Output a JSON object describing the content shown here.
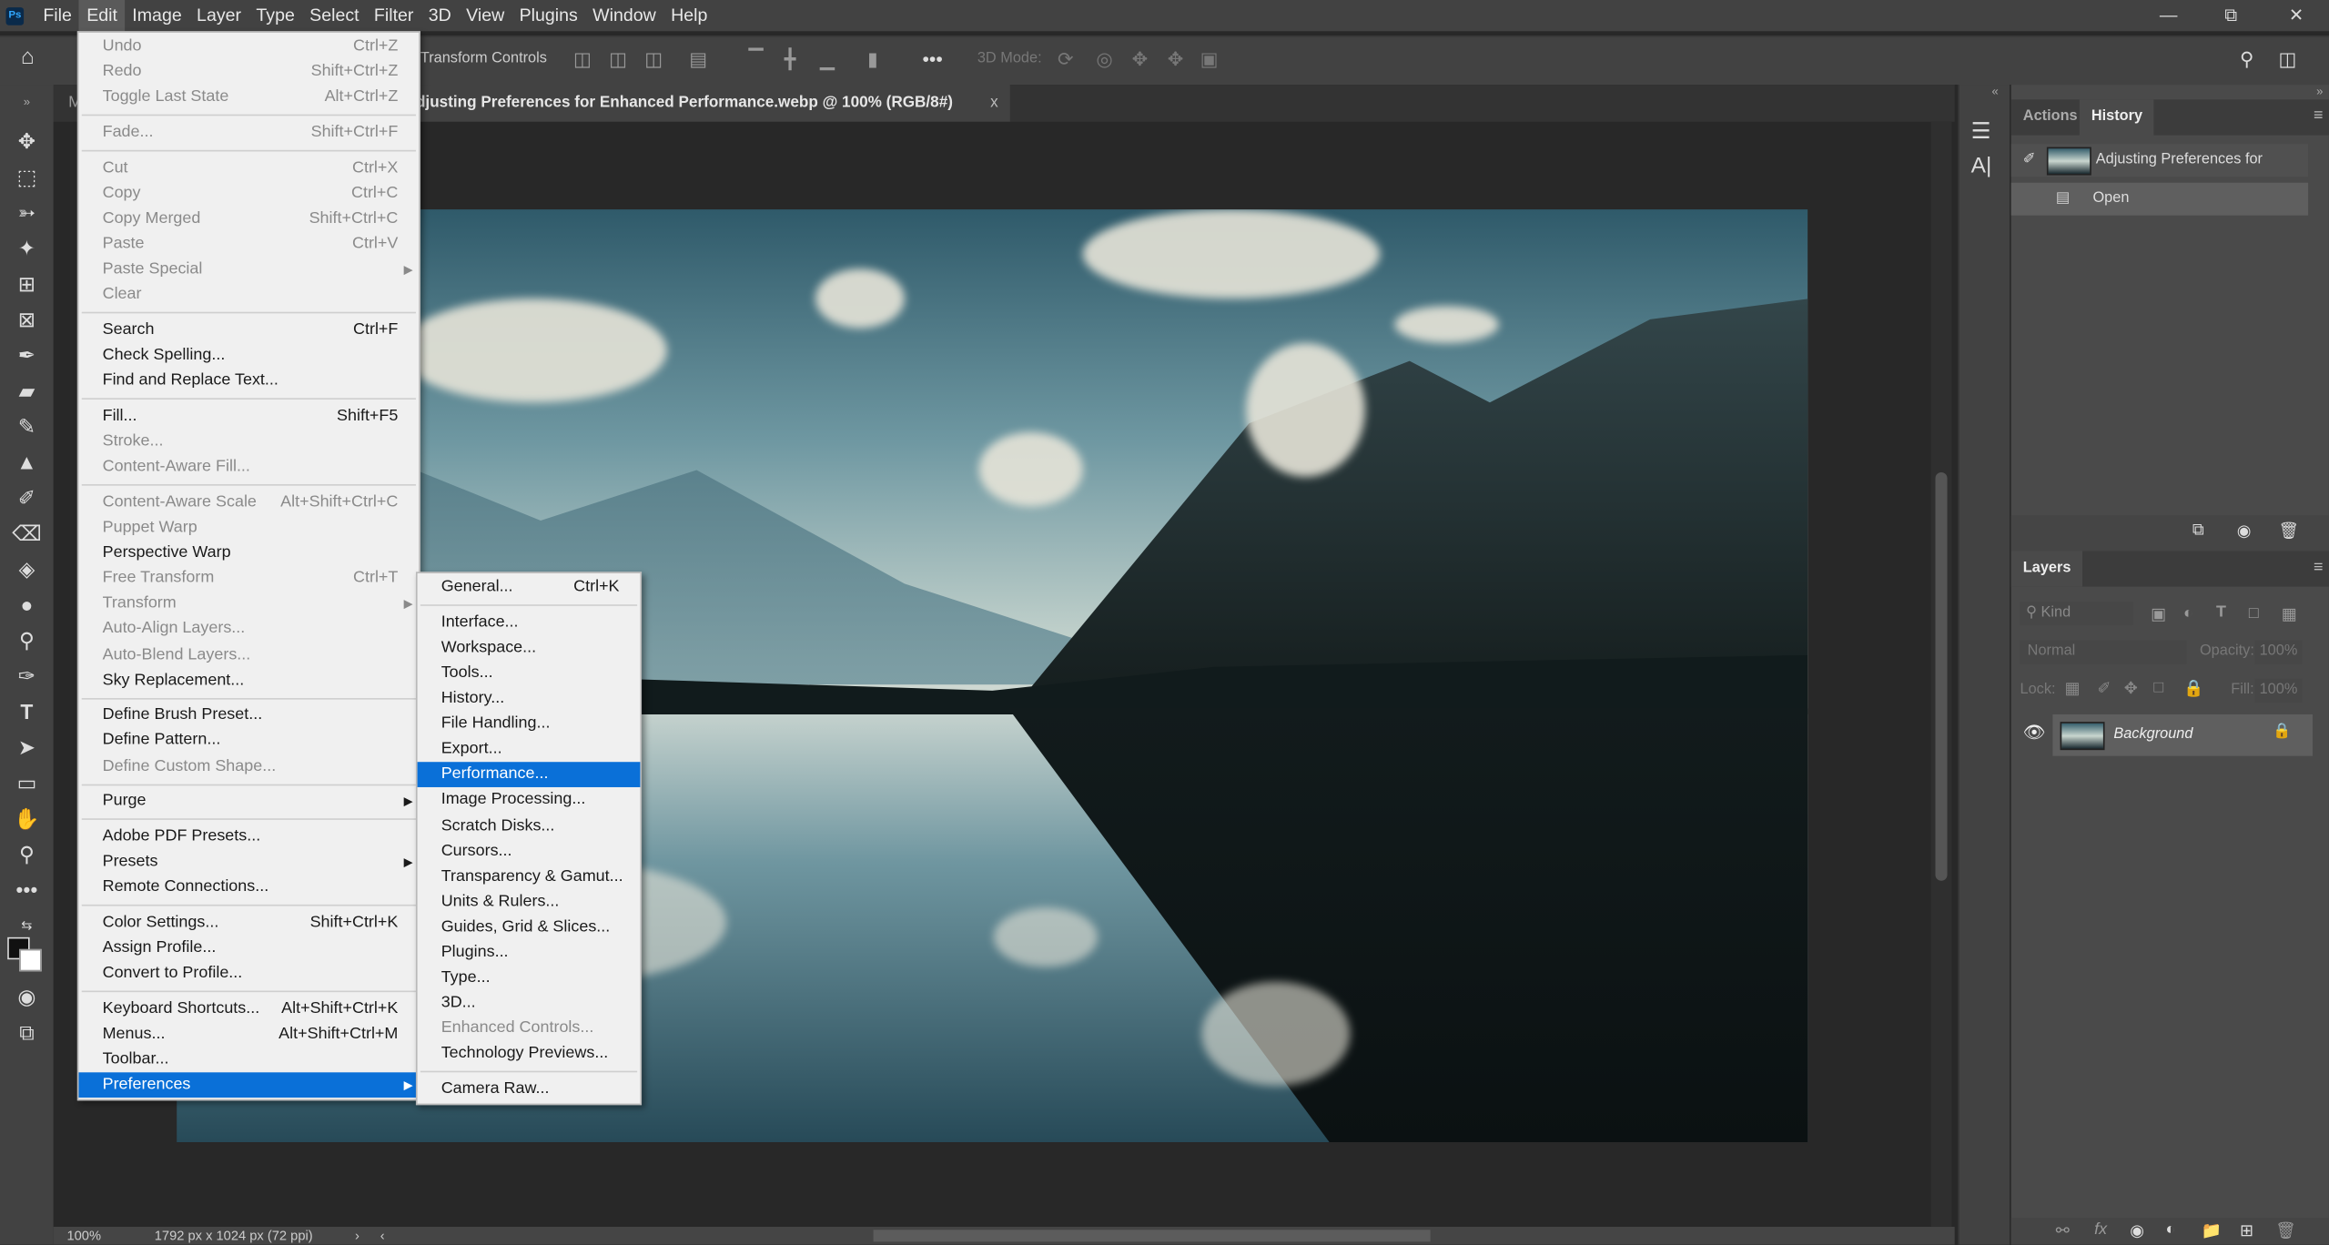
{
  "app": {
    "logo": "Ps",
    "menus": [
      "File",
      "Edit",
      "Image",
      "Layer",
      "Type",
      "Select",
      "Filter",
      "3D",
      "View",
      "Plugins",
      "Window",
      "Help"
    ],
    "active_menu": "Edit",
    "window_controls": [
      "minimize",
      "restore",
      "close"
    ]
  },
  "options_bar": {
    "transform_controls": "Transform Controls",
    "mode_3d": "3D Mode:"
  },
  "document": {
    "tab_title": "djusting Preferences for Enhanced Performance.webp @ 100% (RGB/8#)",
    "close": "x",
    "left_tab_stub": "M"
  },
  "status": {
    "zoom": "100%",
    "dimensions": "1792 px x 1024 px (72 ppi)"
  },
  "edit_menu": [
    {
      "label": "Undo",
      "shortcut": "Ctrl+Z",
      "disabled": true
    },
    {
      "label": "Redo",
      "shortcut": "Shift+Ctrl+Z",
      "disabled": true
    },
    {
      "label": "Toggle Last State",
      "shortcut": "Alt+Ctrl+Z",
      "disabled": true,
      "sep": true
    },
    {
      "label": "Fade...",
      "shortcut": "Shift+Ctrl+F",
      "disabled": true,
      "sep": true
    },
    {
      "label": "Cut",
      "shortcut": "Ctrl+X",
      "disabled": true
    },
    {
      "label": "Copy",
      "shortcut": "Ctrl+C",
      "disabled": true
    },
    {
      "label": "Copy Merged",
      "shortcut": "Shift+Ctrl+C",
      "disabled": true
    },
    {
      "label": "Paste",
      "shortcut": "Ctrl+V",
      "disabled": true
    },
    {
      "label": "Paste Special",
      "disabled": true,
      "submenu": true
    },
    {
      "label": "Clear",
      "disabled": true,
      "sep": true
    },
    {
      "label": "Search",
      "shortcut": "Ctrl+F"
    },
    {
      "label": "Check Spelling..."
    },
    {
      "label": "Find and Replace Text...",
      "sep": true
    },
    {
      "label": "Fill...",
      "shortcut": "Shift+F5"
    },
    {
      "label": "Stroke...",
      "disabled": true
    },
    {
      "label": "Content-Aware Fill...",
      "disabled": true,
      "sep": true
    },
    {
      "label": "Content-Aware Scale",
      "shortcut": "Alt+Shift+Ctrl+C",
      "disabled": true
    },
    {
      "label": "Puppet Warp",
      "disabled": true
    },
    {
      "label": "Perspective Warp"
    },
    {
      "label": "Free Transform",
      "shortcut": "Ctrl+T",
      "disabled": true
    },
    {
      "label": "Transform",
      "disabled": true,
      "submenu": true
    },
    {
      "label": "Auto-Align Layers...",
      "disabled": true
    },
    {
      "label": "Auto-Blend Layers...",
      "disabled": true
    },
    {
      "label": "Sky Replacement...",
      "sep": true
    },
    {
      "label": "Define Brush Preset..."
    },
    {
      "label": "Define Pattern..."
    },
    {
      "label": "Define Custom Shape...",
      "disabled": true,
      "sep": true
    },
    {
      "label": "Purge",
      "submenu": true,
      "sep": true
    },
    {
      "label": "Adobe PDF Presets..."
    },
    {
      "label": "Presets",
      "submenu": true
    },
    {
      "label": "Remote Connections...",
      "sep": true
    },
    {
      "label": "Color Settings...",
      "shortcut": "Shift+Ctrl+K"
    },
    {
      "label": "Assign Profile..."
    },
    {
      "label": "Convert to Profile...",
      "sep": true
    },
    {
      "label": "Keyboard Shortcuts...",
      "shortcut": "Alt+Shift+Ctrl+K"
    },
    {
      "label": "Menus...",
      "shortcut": "Alt+Shift+Ctrl+M"
    },
    {
      "label": "Toolbar..."
    },
    {
      "label": "Preferences",
      "submenu": true,
      "highlighted": true
    }
  ],
  "preferences_menu": [
    {
      "label": "General...",
      "shortcut": "Ctrl+K",
      "sep": true
    },
    {
      "label": "Interface..."
    },
    {
      "label": "Workspace..."
    },
    {
      "label": "Tools..."
    },
    {
      "label": "History..."
    },
    {
      "label": "File Handling..."
    },
    {
      "label": "Export..."
    },
    {
      "label": "Performance...",
      "highlighted": true
    },
    {
      "label": "Image Processing..."
    },
    {
      "label": "Scratch Disks..."
    },
    {
      "label": "Cursors..."
    },
    {
      "label": "Transparency & Gamut..."
    },
    {
      "label": "Units & Rulers..."
    },
    {
      "label": "Guides, Grid & Slices..."
    },
    {
      "label": "Plugins..."
    },
    {
      "label": "Type..."
    },
    {
      "label": "3D..."
    },
    {
      "label": "Enhanced Controls...",
      "disabled": true
    },
    {
      "label": "Technology Previews...",
      "sep": true
    },
    {
      "label": "Camera Raw..."
    }
  ],
  "history_panel": {
    "tabs": [
      "Actions",
      "History"
    ],
    "active_tab": "History",
    "snapshot": "Adjusting Preferences for Enha...",
    "items": [
      "Open"
    ]
  },
  "layers_panel": {
    "tab": "Layers",
    "filter_kind": "Kind",
    "blend_mode": "Normal",
    "opacity_label": "Opacity:",
    "opacity": "100%",
    "lock_label": "Lock:",
    "fill_label": "Fill:",
    "fill": "100%",
    "layers": [
      {
        "name": "Background",
        "visible": true,
        "locked": true
      }
    ]
  },
  "colors": {
    "accent": "#0a70d8",
    "menu_bg": "#f0f0f0",
    "chrome": "#424242",
    "canvas_bg": "#282828"
  }
}
